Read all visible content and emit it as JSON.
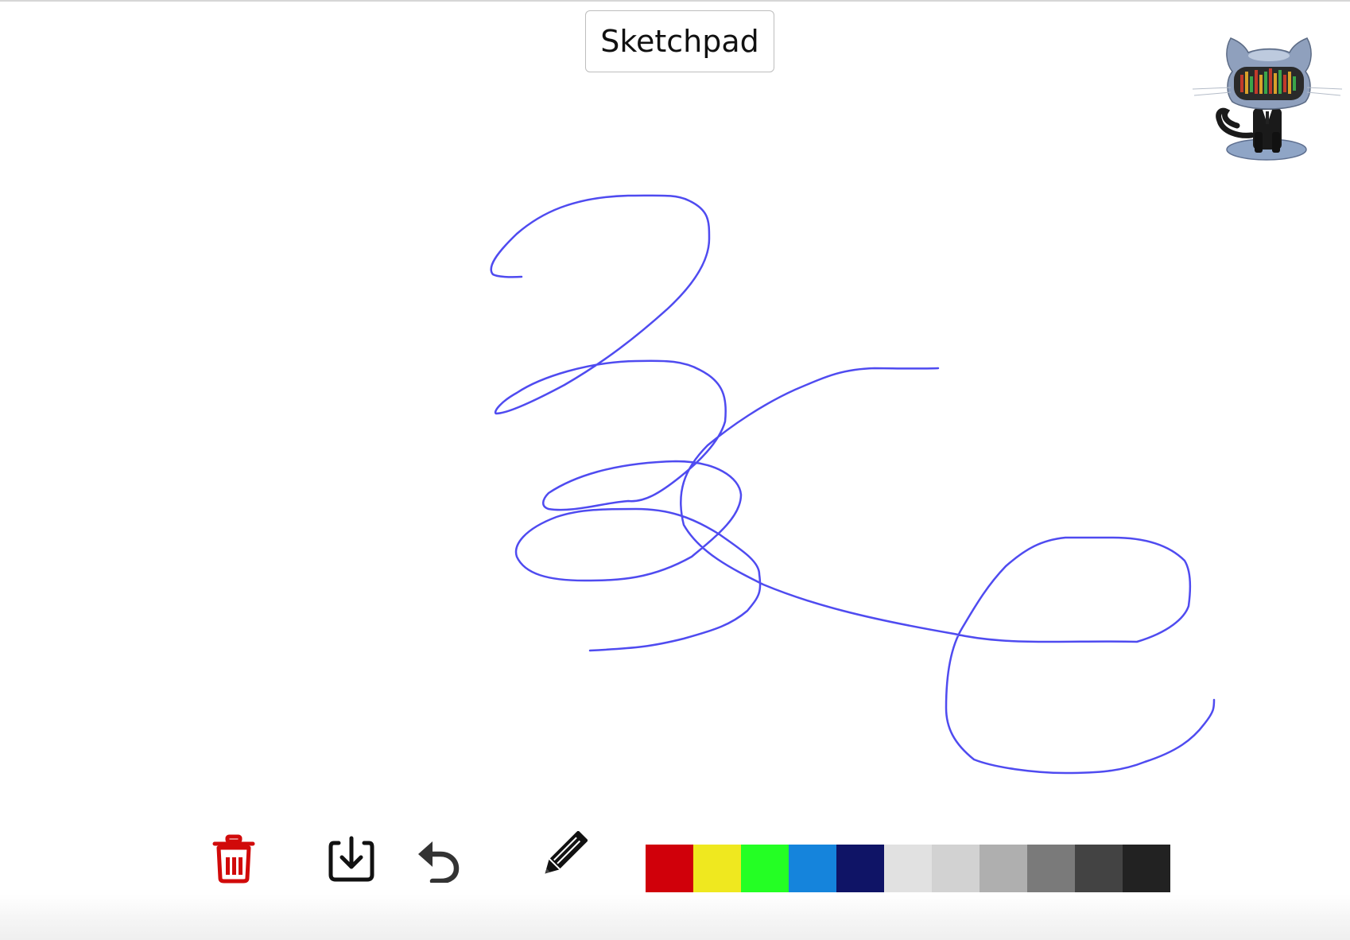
{
  "header": {
    "title_button_label": "Sketchpad"
  },
  "mascot": {
    "icon": "octocat-daft-punk-icon"
  },
  "canvas": {
    "stroke_color": "#4f4bf0"
  },
  "toolbar": {
    "clear_icon": "trash-icon",
    "clear_color": "#d10a0a",
    "download_icon": "download-icon",
    "undo_icon": "undo-icon",
    "pencil_icon": "pencil-icon"
  },
  "palette": {
    "colors": [
      "#d0000a",
      "#efe81f",
      "#24ff24",
      "#1584dc",
      "#0f1466",
      "#e1e1e1",
      "#d2d2d2",
      "#afafaf",
      "#7a7a7a",
      "#434343",
      "#222222"
    ]
  }
}
